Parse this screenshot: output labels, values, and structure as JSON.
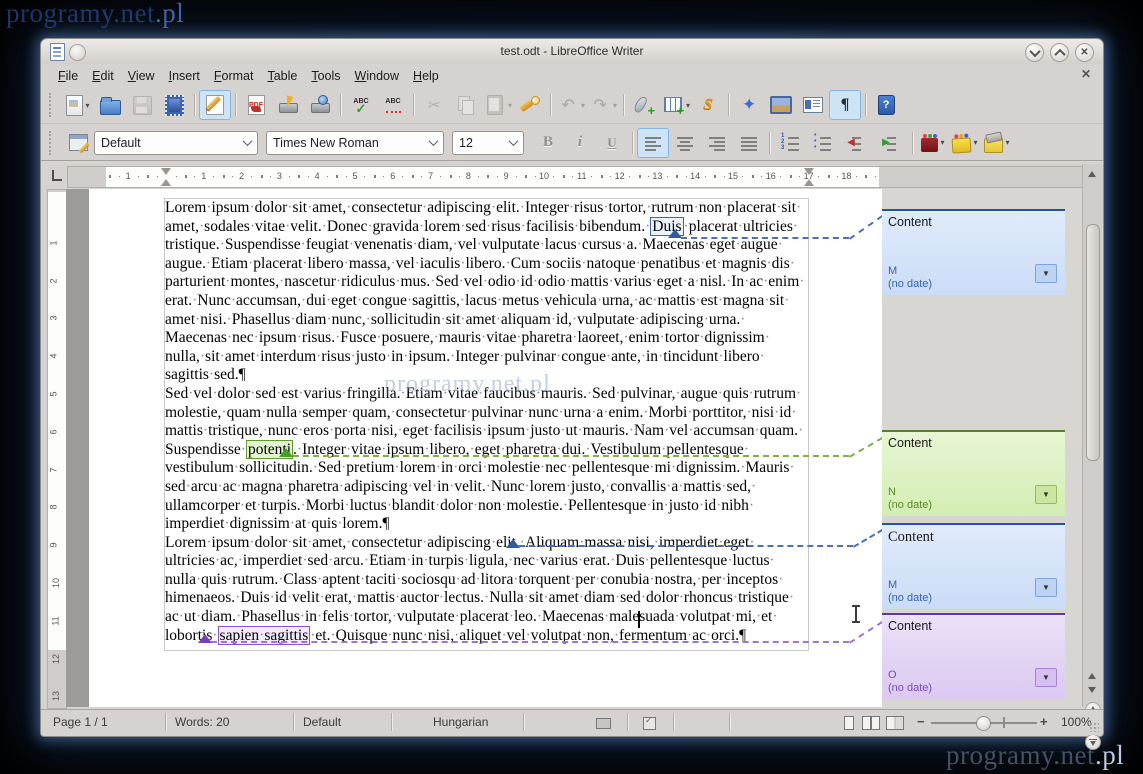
{
  "watermarks": {
    "top_left": "programy.net",
    "top_left_tld": ".pl",
    "bottom_right": "programy.net",
    "bottom_right_tld": ".pl",
    "page": "programy.net.pl"
  },
  "titlebar": {
    "title": "test.odt - LibreOffice Writer"
  },
  "menubar": {
    "items": [
      "File",
      "Edit",
      "View",
      "Insert",
      "Format",
      "Table",
      "Tools",
      "Window",
      "Help"
    ],
    "close_label": "✕"
  },
  "icons": {
    "spelling": "ABC",
    "auto-spellcheck": "ABC",
    "export-pdf": "PDF",
    "cut": "✂",
    "undo": "↶",
    "redo": "↷",
    "draw-functions": "S",
    "navigator": "✦",
    "formatting-marks": "¶",
    "help": "?",
    "bold": "B",
    "italic": "i",
    "underline": "U",
    "decrease-indent": "◀",
    "increase-indent": "▶",
    "dropdown": "▾",
    "close": "✕",
    "comment-menu": "▼"
  },
  "toolbar_standard": [
    {
      "name": "new-document",
      "dropdown": true
    },
    {
      "name": "open"
    },
    {
      "name": "save",
      "disabled": true
    },
    {
      "name": "document-as-email"
    },
    {
      "name": "edit-file",
      "active": true,
      "sep": true
    },
    {
      "name": "export-pdf",
      "sep": true
    },
    {
      "name": "print-direct"
    },
    {
      "name": "page-preview"
    },
    {
      "name": "spelling",
      "sep": true
    },
    {
      "name": "auto-spellcheck"
    },
    {
      "name": "cut",
      "disabled": true,
      "sep": true
    },
    {
      "name": "copy",
      "disabled": true
    },
    {
      "name": "paste",
      "disabled": true,
      "dropdown": true
    },
    {
      "name": "format-paintbrush"
    },
    {
      "name": "undo",
      "disabled": true,
      "dropdown": true,
      "sep": true
    },
    {
      "name": "redo",
      "disabled": true,
      "dropdown": true
    },
    {
      "name": "hyperlink",
      "sep": true
    },
    {
      "name": "insert-table",
      "dropdown": true
    },
    {
      "name": "draw-functions"
    },
    {
      "name": "navigator",
      "sep": true
    },
    {
      "name": "gallery"
    },
    {
      "name": "data-sources"
    },
    {
      "name": "formatting-marks",
      "active": true
    },
    {
      "name": "help",
      "sep": true
    }
  ],
  "toolbar_formatting": {
    "paragraph_style": "Default",
    "font_name": "Times New Roman",
    "font_size": "12",
    "buttons": [
      {
        "name": "bold"
      },
      {
        "name": "italic"
      },
      {
        "name": "underline"
      },
      {
        "name": "align-left",
        "active": true,
        "sep": true
      },
      {
        "name": "align-center"
      },
      {
        "name": "align-right"
      },
      {
        "name": "align-justify"
      },
      {
        "name": "numbering",
        "sep": true
      },
      {
        "name": "bullets"
      },
      {
        "name": "decrease-indent"
      },
      {
        "name": "increase-indent"
      },
      {
        "name": "font-color",
        "dropdown": true,
        "sep": true
      },
      {
        "name": "highlighting",
        "dropdown": true
      },
      {
        "name": "background-color",
        "dropdown": true
      }
    ]
  },
  "ruler": {
    "h_margin_number": "1",
    "h_numbers": [
      "1",
      "2",
      "3",
      "4",
      "5",
      "6",
      "7",
      "8",
      "9",
      "10",
      "11",
      "12",
      "13",
      "14",
      "15",
      "16",
      "17",
      "18"
    ],
    "v_numbers": [
      "1",
      "2",
      "3",
      "4",
      "5",
      "6",
      "7",
      "8",
      "9",
      "10",
      "11",
      "12",
      "13"
    ]
  },
  "document": {
    "paragraphs": [
      {
        "segments": [
          {
            "text": "Lorem ipsum dolor sit amet, consectetur adipiscing elit. Integer risus tortor, rutrum non placerat sit amet, sodales vitae velit. Donec gravida lorem sed risus facilisis bibendum. "
          },
          {
            "text": "Duis",
            "highlight": "blue"
          },
          {
            "text": " placerat ultricies tristique. Suspendisse feugiat venenatis diam, vel vulputate lacus cursus a. Maecenas eget augue augue. Etiam placerat libero massa, vel iaculis libero. Cum sociis natoque penatibus et magnis dis parturient montes, nascetur ridiculus mus. Sed vel odio id odio mattis varius eget a nisl. In ac enim erat. Nunc accumsan, dui eget congue sagittis, lacus metus vehicula urna, ac mattis est magna sit amet nisi. Phasellus diam nunc, sollicitudin sit amet aliquam id, vulputate adipiscing urna. Maecenas nec ipsum risus. Fusce posuere, mauris vitae pharetra laoreet, enim tortor dignissim nulla, sit amet interdum risus justo in ipsum. Integer pulvinar congue ante, in tincidunt libero sagittis sed."
          },
          {
            "text": "¶",
            "mark": true
          }
        ]
      },
      {
        "segments": [
          {
            "text": "Sed vel dolor sed est varius fringilla. Etiam vitae faucibus mauris. Sed pulvinar, augue quis rutrum molestie, quam nulla semper quam, consectetur pulvinar nunc urna a enim. Morbi porttitor, nisi id mattis tristique, nunc eros porta nisi, eget facilisis ipsum justo ut mauris. Nam vel accumsan quam. Suspendisse "
          },
          {
            "text": "potenti",
            "highlight": "green"
          },
          {
            "text": ". Integer vitae ipsum libero, eget pharetra dui. Vestibulum pellentesque vestibulum sollicitudin. Sed pretium lorem in orci molestie nec pellentesque mi dignissim. Mauris sed arcu ac magna pharetra adipiscing vel in velit. Nunc lorem justo, convallis a mattis sed, ullamcorper et turpis. Morbi luctus blandit dolor non molestie. Pellentesque in justo id nibh imperdiet dignissim at quis lorem."
          },
          {
            "text": "¶",
            "mark": true
          }
        ]
      },
      {
        "segments": [
          {
            "text": "Lorem ipsum dolor sit amet, consectetur adipiscing elit. Aliquam massa nisi, imperdiet eget ultricies ac, imperdiet sed arcu. Etiam in turpis ligula, nec varius erat. Duis pellentesque luctus nulla quis rutrum. Class aptent taciti sociosqu ad litora torquent per conubia nostra, per inceptos himenaeos. Duis id velit erat, mattis auctor lectus. Nulla sit amet diam sed dolor rhoncus tristique ac ut diam. Phasellus in felis tortor, vulputate placerat leo. Maecenas malesuada volutpat mi, et lobortis "
          },
          {
            "text": "sapien sagittis",
            "highlight": "purple"
          },
          {
            "text": " et. Quisque nunc nisi, aliquet vel volutpat non, fermentum ac orci."
          },
          {
            "text": "¶",
            "mark": true
          }
        ]
      }
    ]
  },
  "comments": [
    {
      "text": "Content",
      "author": "M",
      "date": "(no date)",
      "color": "blue"
    },
    {
      "text": "Content",
      "author": "N",
      "date": "(no date)",
      "color": "green"
    },
    {
      "text": "Content",
      "author": "M",
      "date": "(no date)",
      "color": "blue",
      "font": "serif"
    },
    {
      "text": "Content",
      "author": "O",
      "date": "(no date)",
      "color": "purple"
    }
  ],
  "comment_colors": {
    "blue": {
      "border": "#2a5296",
      "fill_top": "#e0ebfb",
      "fill_bottom": "#cbdcf7",
      "text": "#3563ae",
      "line": "#4a6fb8",
      "anchor": "#2d5aa0",
      "dd": "#bcd4f2",
      "ddb": "#7da3d8"
    },
    "green": {
      "border": "#577f2e",
      "fill_top": "#e8f6d4",
      "fill_bottom": "#d3edb2",
      "text": "#5a8a2a",
      "line": "#79b24a",
      "anchor": "#44a024",
      "dd": "#cbe69f",
      "ddb": "#93bb60"
    },
    "purple": {
      "border": "#5f3a92",
      "fill_top": "#ebe1f8",
      "fill_bottom": "#dbc9f1",
      "text": "#7b4ab8",
      "line": "#9e74cc",
      "anchor": "#7a3fb5",
      "dd": "#d7bff0",
      "ddb": "#a583cf"
    }
  },
  "statusbar": {
    "page": "Page 1 / 1",
    "word_count": "Words: 20",
    "page_style": "Default",
    "language": "Hungarian",
    "zoom_level": "100%"
  }
}
